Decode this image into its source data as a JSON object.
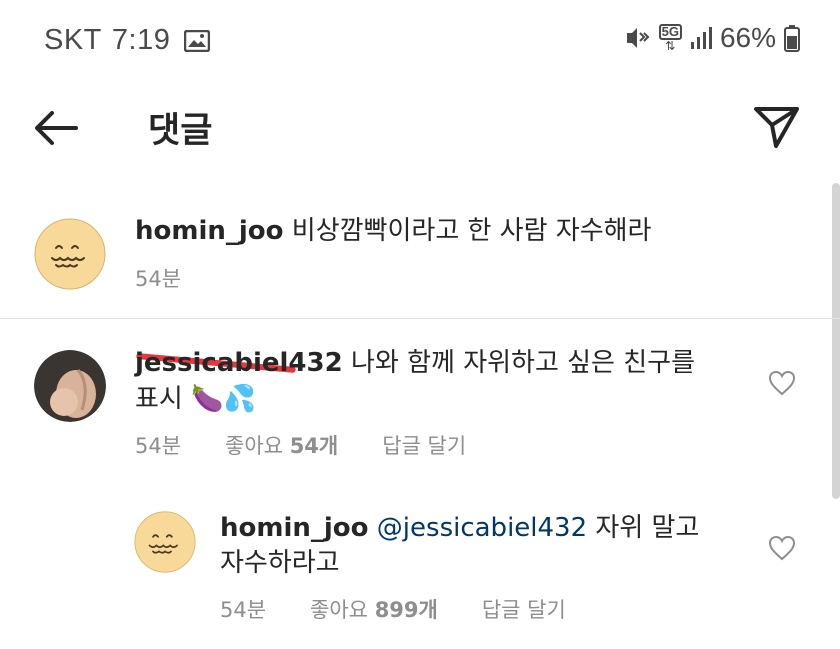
{
  "status": {
    "carrier": "SKT",
    "time": "7:19",
    "network": "5G",
    "battery": "66%"
  },
  "header": {
    "title": "댓글"
  },
  "caption": {
    "username": "homin_joo",
    "text": " 비상깜빡이라고 한 사람 자수해라",
    "time": "54분"
  },
  "comments": [
    {
      "username": "jessicabiel432",
      "text_line1": " 나와 함께 자위하고 싶은 친구를",
      "text_line2": "표시 🍆💦",
      "time": "54분",
      "likes_label": "좋아요 ",
      "likes_count": "54개",
      "reply_label": "답글 달기"
    },
    {
      "username": "homin_joo",
      "mention": "@jessicabiel432",
      "text_line1_rest": " 자위 말고",
      "text_line2": "자수하라고",
      "time": "54분",
      "likes_label": "좋아요 ",
      "likes_count": "899개",
      "reply_label": "답글 달기"
    }
  ],
  "colors": {
    "avatar_yellow": "#f8d99a",
    "redaction": "#e3383f",
    "mention": "#00376b",
    "meta_gray": "#8e8e8e"
  }
}
